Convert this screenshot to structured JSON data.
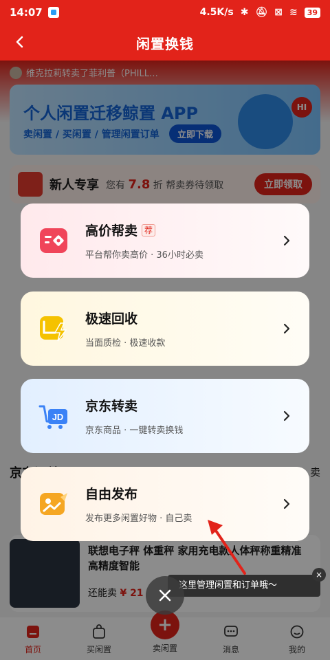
{
  "status_bar": {
    "time": "14:07",
    "network_speed": "4.5K/s",
    "battery": "39"
  },
  "header": {
    "title": "闲置换钱"
  },
  "background": {
    "ticker_text": "维克拉莉转卖了菲利普（PHILL…",
    "banner_title": "个人闲置迁移鲸置 APP",
    "banner_subtitle": "卖闲置 / 买闲置 / 管理闲置订单",
    "banner_button": "立即下载",
    "banner_hi": "HI",
    "newuser_title": "新人专享",
    "newuser_pre": "您有",
    "newuser_discount": "7.8",
    "newuser_post": "折 帮卖券待领取",
    "newuser_button": "立即领取",
    "section_left_partial": "京东订单",
    "section_right_partial": "…卖",
    "product_title": "联想电子秤 体重秤 家用充电款人体秤称重精准高精度智能",
    "product_price_label": "还能卖",
    "product_price": "¥ 21"
  },
  "options": [
    {
      "title": "高价帮卖",
      "badge": "荐",
      "subtitle": "平台帮你卖高价 · 36小时必卖",
      "icon": "tag-icon",
      "color": "#f0455a"
    },
    {
      "title": "极速回收",
      "badge": "",
      "subtitle": "当面质检 · 极速收款",
      "icon": "lightning-icon",
      "color": "#f5c200"
    },
    {
      "title": "京东转卖",
      "badge": "",
      "subtitle": "京东商品 · 一键转卖换钱",
      "icon": "jd-cart-icon",
      "color": "#3b82f6"
    },
    {
      "title": "自由发布",
      "badge": "",
      "subtitle": "发布更多闲置好物 · 自己卖",
      "icon": "photo-icon",
      "color": "#f5a623"
    }
  ],
  "tooltip": {
    "text": "这里管理闲置和订单哦～",
    "close": "×"
  },
  "tabbar": {
    "items": [
      {
        "label": "首页",
        "icon": "home-icon"
      },
      {
        "label": "买闲置",
        "icon": "bag-icon"
      },
      {
        "label": "卖闲置",
        "icon": "plus-icon"
      },
      {
        "label": "消息",
        "icon": "chat-icon"
      },
      {
        "label": "我的",
        "icon": "profile-icon"
      }
    ]
  }
}
